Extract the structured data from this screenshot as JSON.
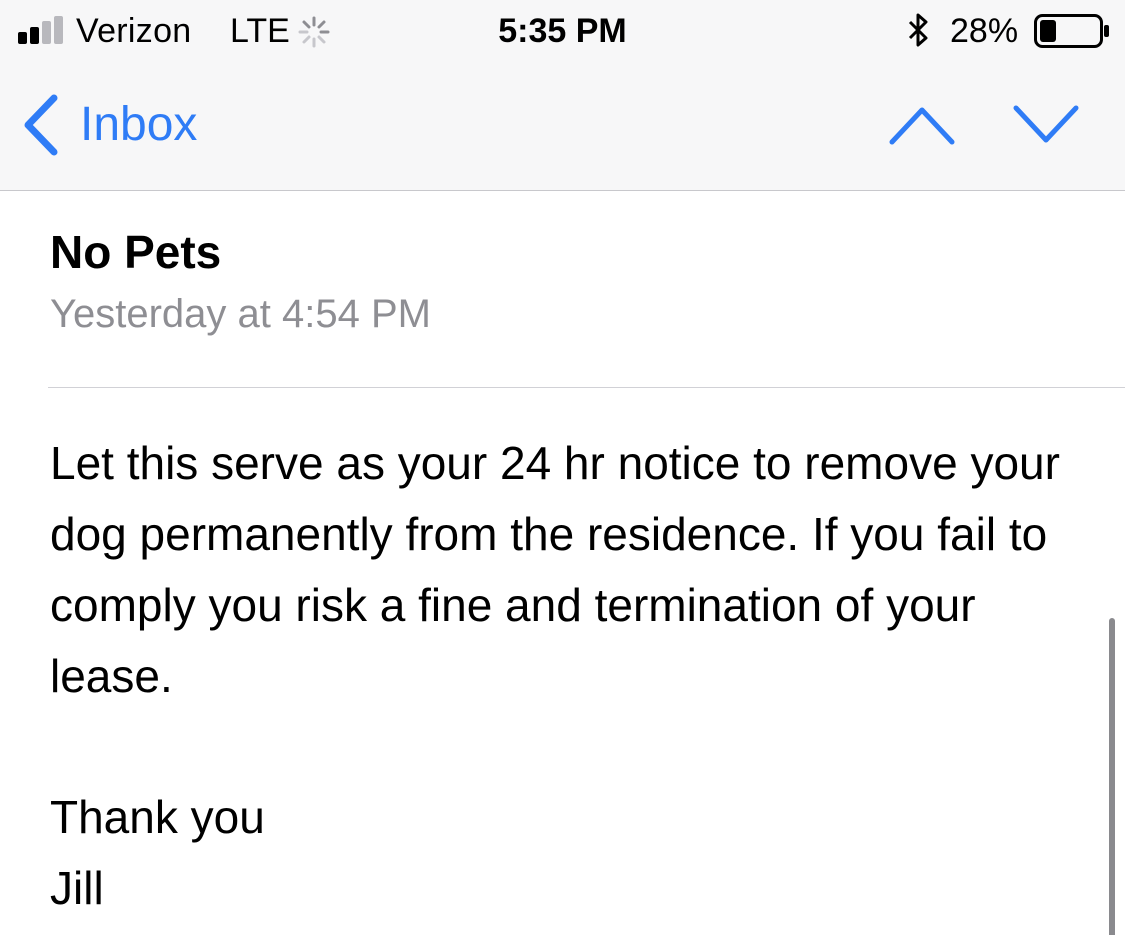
{
  "status_bar": {
    "carrier": "Verizon",
    "network": "LTE",
    "time": "5:35 PM",
    "battery_percent": "28%",
    "battery_level": 0.28,
    "icons": [
      "signal-bars-icon",
      "activity-spinner-icon",
      "bluetooth-icon",
      "battery-icon"
    ]
  },
  "nav": {
    "back_label": "Inbox",
    "icons": [
      "chevron-left-icon",
      "chevron-up-icon",
      "chevron-down-icon"
    ]
  },
  "message": {
    "subject": "No Pets",
    "date": "Yesterday at 4:54 PM",
    "body": "Let this serve as your 24 hr notice to remove your dog permanently from the residence. If you fail to comply you risk a fine and termination of your lease.",
    "closing": "Thank you",
    "signature": "Jill"
  },
  "colors": {
    "accent": "#2f7cf6",
    "secondary_text": "#8e8e93",
    "chrome_background": "#f7f7f8"
  }
}
